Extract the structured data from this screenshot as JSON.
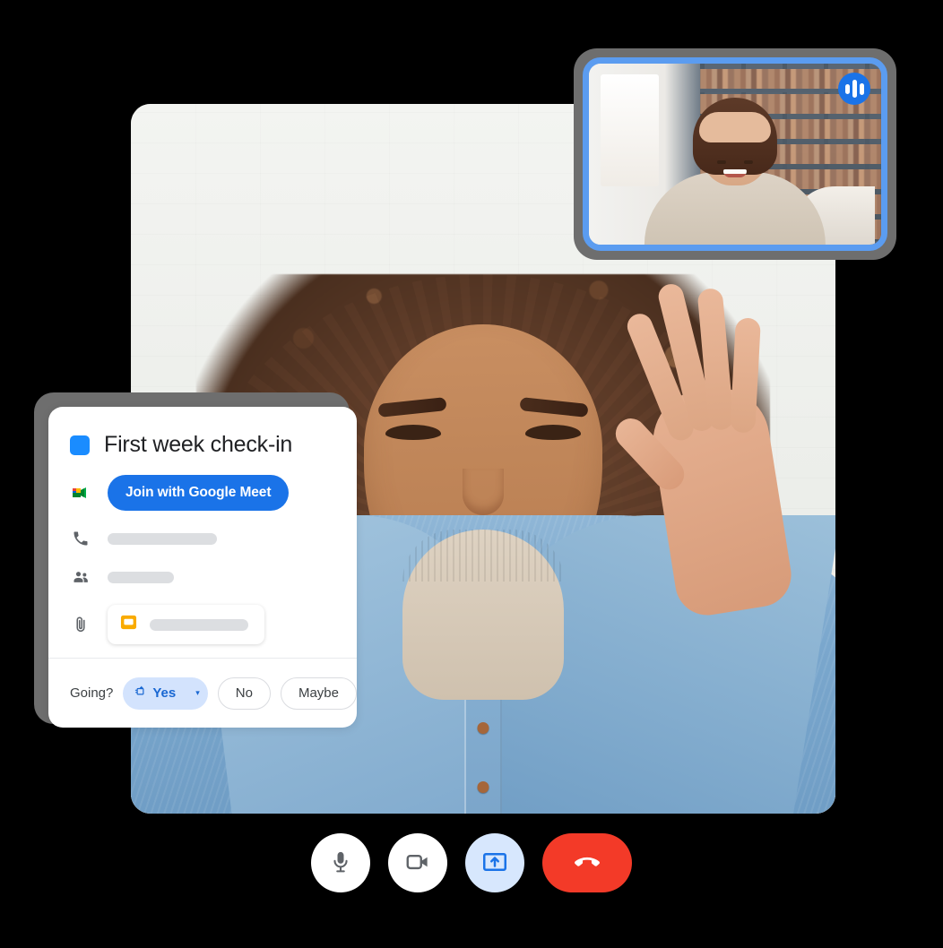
{
  "app": {
    "name": "Google Meet video call",
    "accent_blue": "#1a73e8",
    "chip_blue": "#d3e3fd",
    "hangup_red": "#f33a28",
    "pip_border": "#5b9cf0"
  },
  "main_tile": {
    "name": "main-video-feed",
    "description": "Smiling woman with curly hair in denim shirt waving"
  },
  "pip_tile": {
    "name": "picture-in-picture-feed",
    "description": "Woman in beige top in front of bookshelves",
    "audio_badge": "audio-activity-icon"
  },
  "event_card": {
    "color_dot": "#1a8cff",
    "title": "First week check-in",
    "meet_icon": "google-meet-icon",
    "join_button": "Join with Google Meet",
    "rows": [
      {
        "icon": "phone-icon",
        "value_redacted": true
      },
      {
        "icon": "guests-icon",
        "value_redacted": true
      },
      {
        "icon": "attachment-icon",
        "value_redacted": true,
        "chip_icon": "google-slides-icon"
      }
    ],
    "footer": {
      "going_label": "Going?",
      "yes_label": "Yes",
      "yes_icon": "rsvp-location-icon",
      "yes_caret": "▾",
      "no_label": "No",
      "maybe_label": "Maybe"
    }
  },
  "controls": [
    {
      "name": "microphone-button",
      "icon": "microphone-icon",
      "state": "on"
    },
    {
      "name": "camera-button",
      "icon": "video-camera-icon",
      "state": "on"
    },
    {
      "name": "present-button",
      "icon": "present-screen-icon",
      "state": "active"
    },
    {
      "name": "hangup-button",
      "icon": "phone-hangup-icon",
      "state": "default"
    }
  ]
}
